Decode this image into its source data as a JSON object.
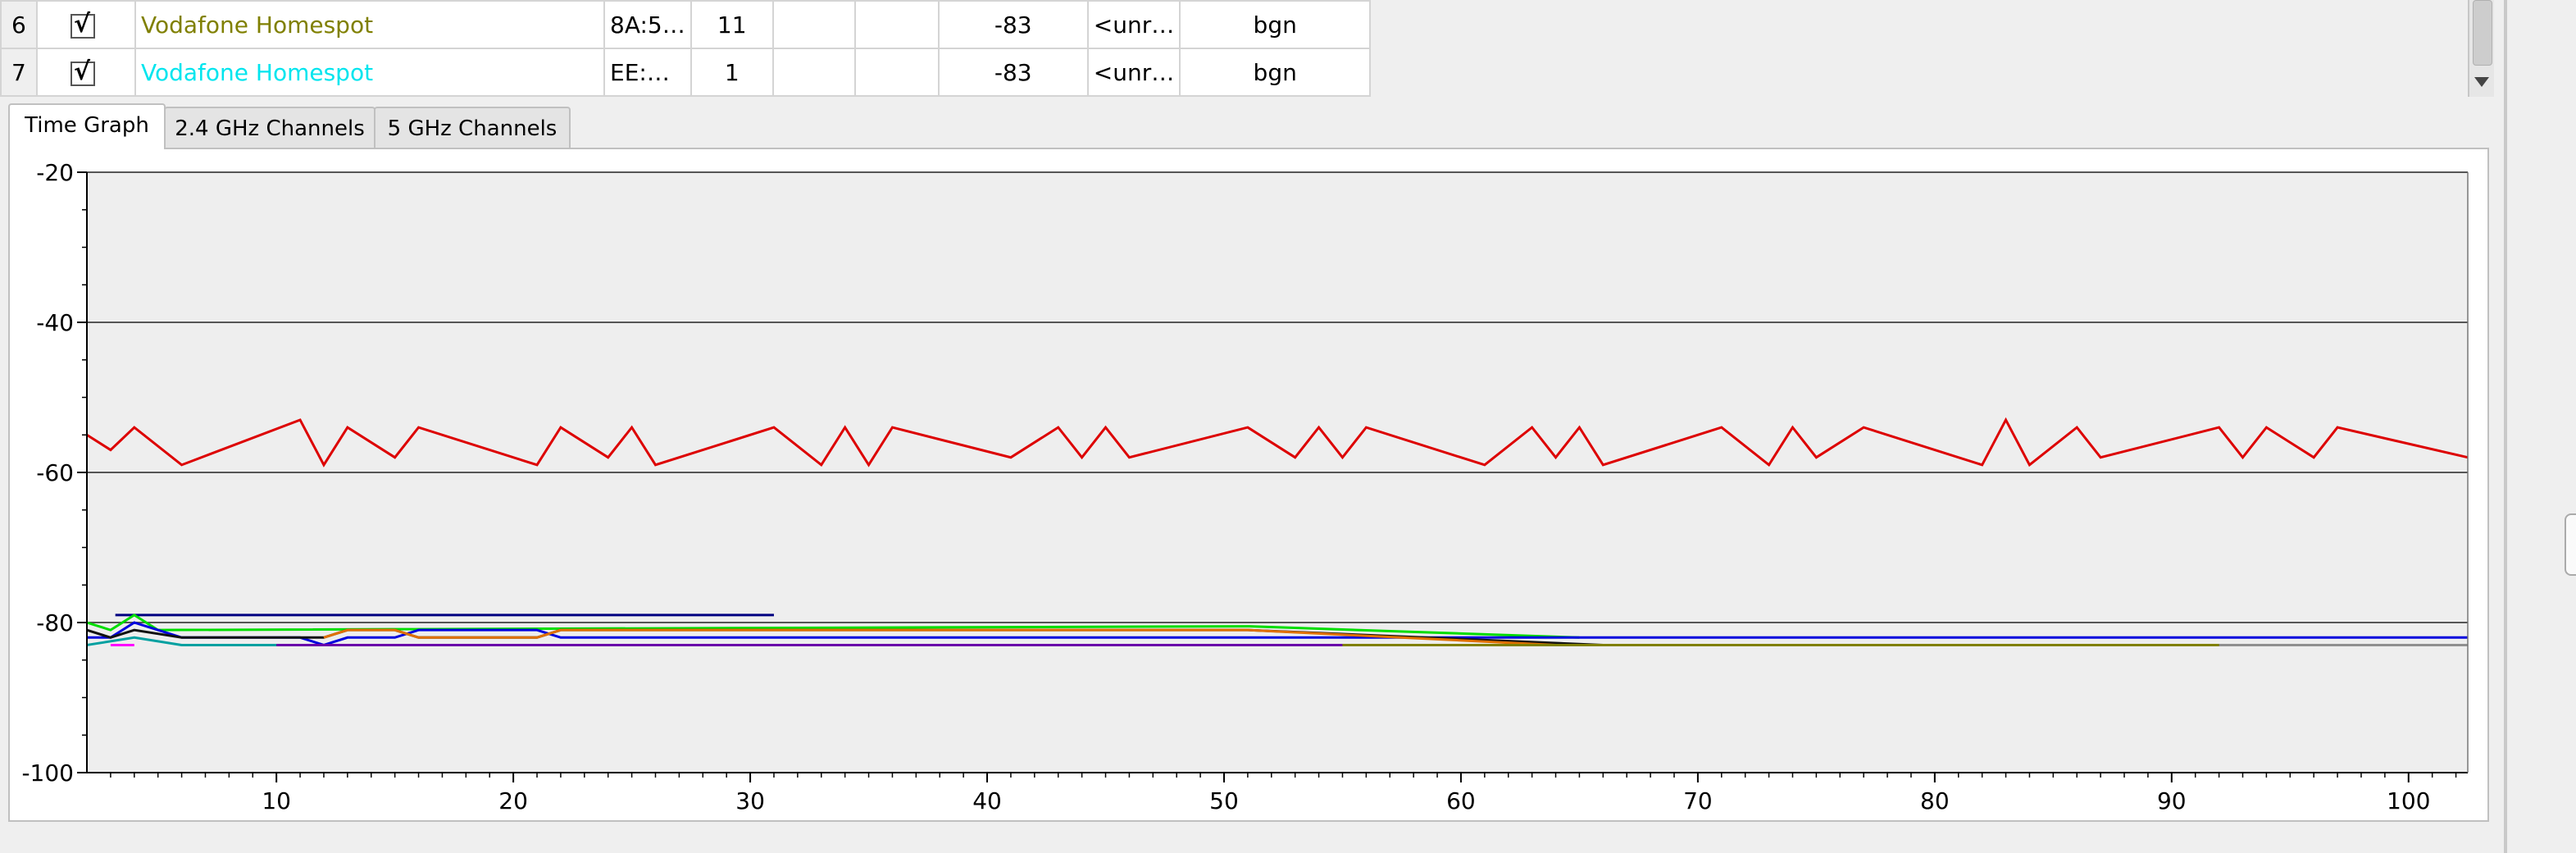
{
  "network_table": {
    "rows": [
      {
        "num": "6",
        "checked": true,
        "ssid": "Vodafone Homespot",
        "ssid_color": "#808000",
        "bssid": "8A:5…",
        "channel": "11",
        "c4": "",
        "c5": "",
        "signal": "-83",
        "security": "<unr…",
        "mode": "bgn"
      },
      {
        "num": "7",
        "checked": true,
        "ssid": "Vodafone Homespot",
        "ssid_color": "#00e5ee",
        "bssid": "EE:…",
        "channel": "1",
        "c4": "",
        "c5": "",
        "signal": "-83",
        "security": "<unr…",
        "mode": "bgn"
      }
    ]
  },
  "tabs": [
    {
      "label": "Time Graph",
      "active": true
    },
    {
      "label": "2.4 GHz Channels",
      "active": false
    },
    {
      "label": "5 GHz Channels",
      "active": false
    }
  ],
  "chart_data": {
    "type": "line",
    "title": "",
    "xlabel": "",
    "ylabel": "",
    "xlim": [
      2,
      102.5
    ],
    "ylim": [
      -100,
      -20
    ],
    "x_ticks": [
      10,
      20,
      30,
      40,
      50,
      60,
      70,
      80,
      90,
      100
    ],
    "y_ticks": [
      -20,
      -40,
      -60,
      -80,
      -100
    ],
    "y_tick_labels": [
      "-20",
      "-40",
      "-60",
      "-80",
      "-100"
    ],
    "grid": "horizontal",
    "background": "#eeeeee",
    "series": [
      {
        "color": "#dd0000",
        "x": [
          2,
          3,
          4,
          6,
          11,
          12,
          13,
          15,
          16,
          21,
          22,
          24,
          25,
          26,
          31,
          33,
          34,
          35,
          36,
          41,
          43,
          44,
          45,
          46,
          51,
          53,
          54,
          55,
          56,
          61,
          63,
          64,
          65,
          66,
          71,
          73,
          74,
          75,
          77,
          82,
          83,
          84,
          86,
          87,
          92,
          93,
          94,
          96,
          97,
          102.5
        ],
        "y": [
          -55,
          -57,
          -54,
          -59,
          -53,
          -59,
          -54,
          -58,
          -54,
          -59,
          -54,
          -58,
          -54,
          -59,
          -54,
          -59,
          -54,
          -59,
          -54,
          -58,
          -54,
          -58,
          -54,
          -58,
          -54,
          -58,
          -54,
          -58,
          -54,
          -59,
          -54,
          -58,
          -54,
          -59,
          -54,
          -59,
          -54,
          -58,
          -54,
          -59,
          -53,
          -59,
          -54,
          -58,
          -54,
          -58,
          -54,
          -58,
          -54,
          -58
        ]
      },
      {
        "color": "#000080",
        "x": [
          3.2,
          31
        ],
        "y": [
          -79,
          -79
        ]
      },
      {
        "color": "#00dd00",
        "x": [
          2,
          3,
          4,
          5,
          51,
          65
        ],
        "y": [
          -80,
          -81,
          -79,
          -81,
          -80.5,
          -82
        ]
      },
      {
        "color": "#0000dd",
        "x": [
          2,
          3,
          4,
          6,
          11,
          12,
          13,
          15,
          16,
          21,
          22,
          24,
          51,
          65,
          102.5
        ],
        "y": [
          -82,
          -82,
          -80,
          -82,
          -82,
          -83,
          -82,
          -82,
          -81,
          -81,
          -82,
          -82,
          -82,
          -82,
          -82
        ]
      },
      {
        "color": "#111111",
        "x": [
          2,
          3,
          4,
          6,
          11,
          12,
          13,
          15,
          16,
          21,
          22,
          51,
          66,
          102.5
        ],
        "y": [
          -81,
          -82,
          -81,
          -82,
          -82,
          -82,
          -81,
          -81,
          -82,
          -82,
          -81,
          -81,
          -83,
          -83
        ]
      },
      {
        "color": "#e07000",
        "x": [
          12,
          13,
          15,
          16,
          21,
          22,
          51,
          64
        ],
        "y": [
          -82,
          -81,
          -81,
          -82,
          -82,
          -81,
          -81,
          -83
        ]
      },
      {
        "color": "#00a0a0",
        "x": [
          2,
          4,
          6,
          12
        ],
        "y": [
          -83,
          -82,
          -83,
          -83
        ]
      },
      {
        "color": "#6a00aa",
        "x": [
          10,
          55
        ],
        "y": [
          -83,
          -83
        ]
      },
      {
        "color": "#ff00ff",
        "x": [
          3,
          4
        ],
        "y": [
          -83,
          -83
        ]
      },
      {
        "color": "#808000",
        "x": [
          55,
          92
        ],
        "y": [
          -83,
          -83
        ]
      },
      {
        "color": "#909090",
        "x": [
          92,
          102.5
        ],
        "y": [
          -83,
          -83
        ]
      }
    ]
  }
}
